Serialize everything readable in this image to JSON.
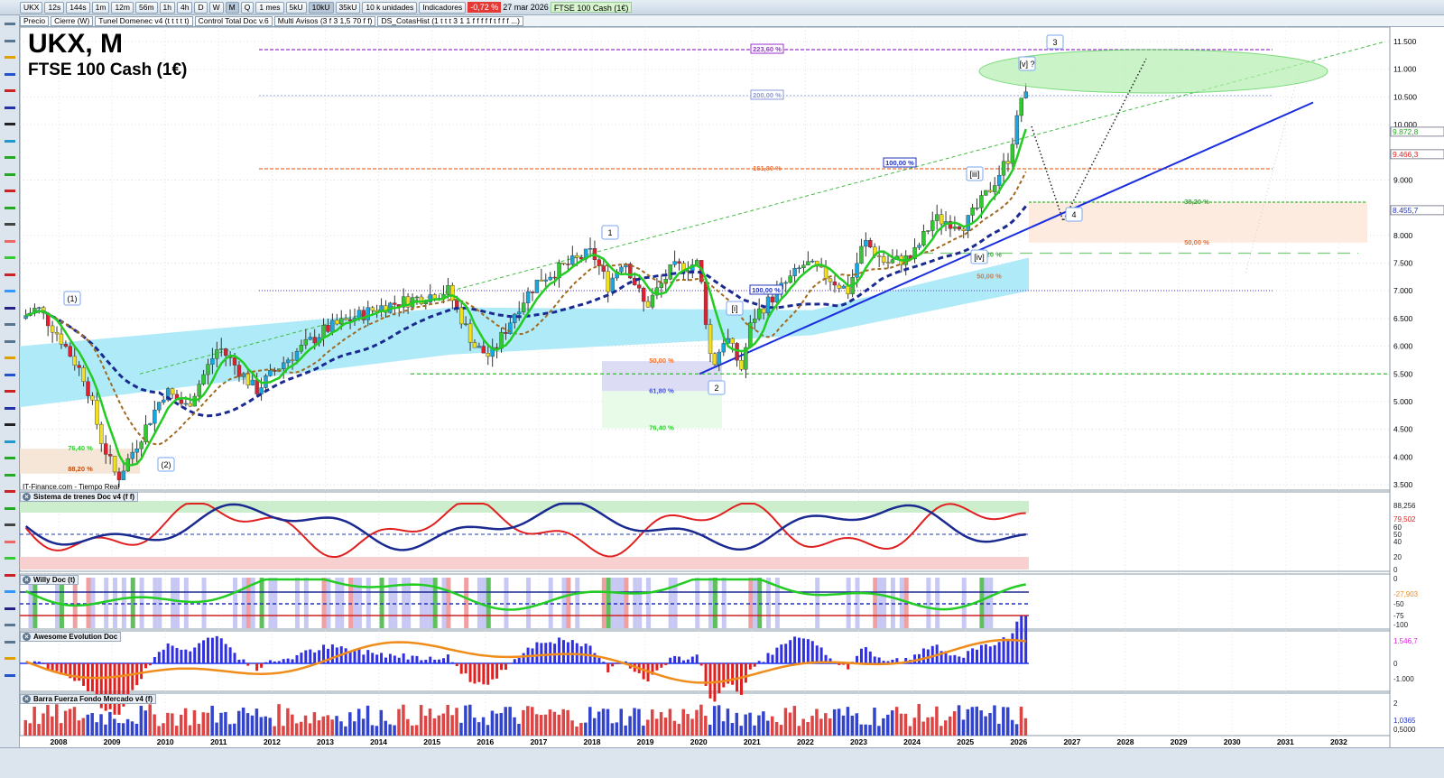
{
  "toolbar": {
    "symbol": "UKX",
    "timeframes": [
      "12s",
      "144s",
      "1m",
      "12m",
      "56m",
      "1h",
      "4h",
      "D",
      "W",
      "M",
      "Q"
    ],
    "active_tf": "M",
    "period": "1 mes",
    "units_buttons": [
      "5kU",
      "10kU",
      "35kU"
    ],
    "active_unit": "10kU",
    "units": "10 k unidades",
    "indicators": "Indicadores",
    "change": "-0,72 %",
    "date": "27 mar 2026",
    "instrument": "FTSE 100 Cash (1€)"
  },
  "layers": [
    "Precio",
    "Cierre (W)",
    "Tunel Domenec v4 (t t t t t)",
    "Control Total Doc v.6",
    "Multi Avisos (3 f 3 1,5 70 f f)",
    "DS_CotasHist (1 t t t 3 1 1 f f f f f t f f f ...)"
  ],
  "chart": {
    "title": "UKX, M",
    "subtitle": "FTSE 100 Cash (1€)",
    "source": "IT-Finance.com - Tiempo Real"
  },
  "price_axis": [
    "11.500",
    "11.000",
    "10.500",
    "10.000",
    "9.000",
    "8.000",
    "7.500",
    "7.000",
    "6.500",
    "6.000",
    "5.500",
    "5.000",
    "4.500",
    "4.000",
    "3.500"
  ],
  "price_tags": [
    {
      "text": "9.872,8",
      "color": "#22aa22",
      "price": 9872.8
    },
    {
      "text": "9.466,3",
      "color": "#dd2222",
      "price": 9466.3
    },
    {
      "text": "8.455,7",
      "color": "#2233bb",
      "price": 8455.7
    }
  ],
  "fib_labels": [
    {
      "text": "223,60 %",
      "price": 11353,
      "color": "#9b30d0"
    },
    {
      "text": "200,00 %",
      "price": 10523,
      "color": "#8899dd"
    },
    {
      "text": "161,80 %",
      "price": 9203,
      "color": "#f07030"
    },
    {
      "text": "100,00 %",
      "price": 9300,
      "color": "#2233bb"
    },
    {
      "text": "100,00 %",
      "price": 7004,
      "color": "#2233bb"
    },
    {
      "text": "38,20 %",
      "price": 8600,
      "color": "#33aa33"
    },
    {
      "text": "50,00 %",
      "price": 7870,
      "color": "#f07030"
    },
    {
      "text": "50,00 %",
      "price": 5730,
      "color": "#f07030"
    },
    {
      "text": "61,80 %",
      "price": 5190,
      "color": "#4455cc"
    },
    {
      "text": "76,40 %",
      "price": 4520,
      "color": "#33cc33"
    },
    {
      "text": "76,40 %",
      "price": 4150,
      "color": "#33cc33"
    },
    {
      "text": "88,20 %",
      "price": 3780,
      "color": "#c05010"
    },
    {
      "text": "38,20 %",
      "price": 7650,
      "color": "#33aa33"
    },
    {
      "text": "50,00 %",
      "price": 7260,
      "color": "#f07030"
    }
  ],
  "wave_labels": [
    "(1)",
    "(2)",
    "1",
    "2",
    "[i]",
    "[iii]",
    "[iv]",
    "[v] ?",
    "3",
    "4"
  ],
  "years": [
    "2008",
    "2009",
    "2010",
    "2011",
    "2012",
    "2013",
    "2014",
    "2015",
    "2016",
    "2017",
    "2018",
    "2019",
    "2020",
    "2021",
    "2022",
    "2023",
    "2024",
    "2025",
    "2026",
    "2027",
    "2028",
    "2029",
    "2030",
    "2031",
    "2032"
  ],
  "chart_data": {
    "type": "candlestick",
    "anchors": [
      [
        2007.3,
        6500
      ],
      [
        2007.6,
        6700
      ],
      [
        2008.0,
        6200
      ],
      [
        2008.5,
        5400
      ],
      [
        2008.8,
        4300
      ],
      [
        2009.1,
        3600
      ],
      [
        2009.5,
        4300
      ],
      [
        2010.0,
        5200
      ],
      [
        2010.4,
        4900
      ],
      [
        2011.0,
        6000
      ],
      [
        2011.7,
        5200
      ],
      [
        2012.2,
        5700
      ],
      [
        2013.0,
        6300
      ],
      [
        2013.5,
        6500
      ],
      [
        2014.0,
        6700
      ],
      [
        2015.3,
        7000
      ],
      [
        2015.8,
        6000
      ],
      [
        2016.1,
        5800
      ],
      [
        2016.6,
        6700
      ],
      [
        2017.0,
        7200
      ],
      [
        2018.0,
        7700
      ],
      [
        2018.3,
        7100
      ],
      [
        2018.6,
        7600
      ],
      [
        2019.0,
        6700
      ],
      [
        2019.5,
        7400
      ],
      [
        2020.0,
        7500
      ],
      [
        2020.25,
        5600
      ],
      [
        2020.5,
        6200
      ],
      [
        2020.8,
        5600
      ],
      [
        2021.0,
        6500
      ],
      [
        2021.5,
        7000
      ],
      [
        2022.0,
        7500
      ],
      [
        2022.5,
        7200
      ],
      [
        2022.8,
        7000
      ],
      [
        2023.1,
        7900
      ],
      [
        2023.5,
        7500
      ],
      [
        2024.0,
        7600
      ],
      [
        2024.4,
        8300
      ],
      [
        2025.0,
        8200
      ],
      [
        2025.3,
        8600
      ],
      [
        2025.5,
        8900
      ],
      [
        2025.8,
        9400
      ],
      [
        2026.0,
        10200
      ],
      [
        2026.1,
        10800
      ],
      [
        2026.2,
        9870
      ]
    ]
  },
  "panels": [
    {
      "name": "Sistema de trenes Doc v4 (f f)",
      "axis": [
        "88,256",
        "79,502",
        "60",
        "50",
        "40",
        "20",
        "0"
      ]
    },
    {
      "name": "Willy Doc (t)",
      "axis": [
        "0",
        "-27,903",
        "-50",
        "-75",
        "-100"
      ]
    },
    {
      "name": "Awesome Evolution Doc",
      "axis": [
        "1.546,7",
        "0",
        "-1.000"
      ]
    },
    {
      "name": "Barra Fuerza Fondo Mercado v4 (f)",
      "axis": [
        "2",
        "1,0365",
        "0,5000"
      ]
    }
  ]
}
